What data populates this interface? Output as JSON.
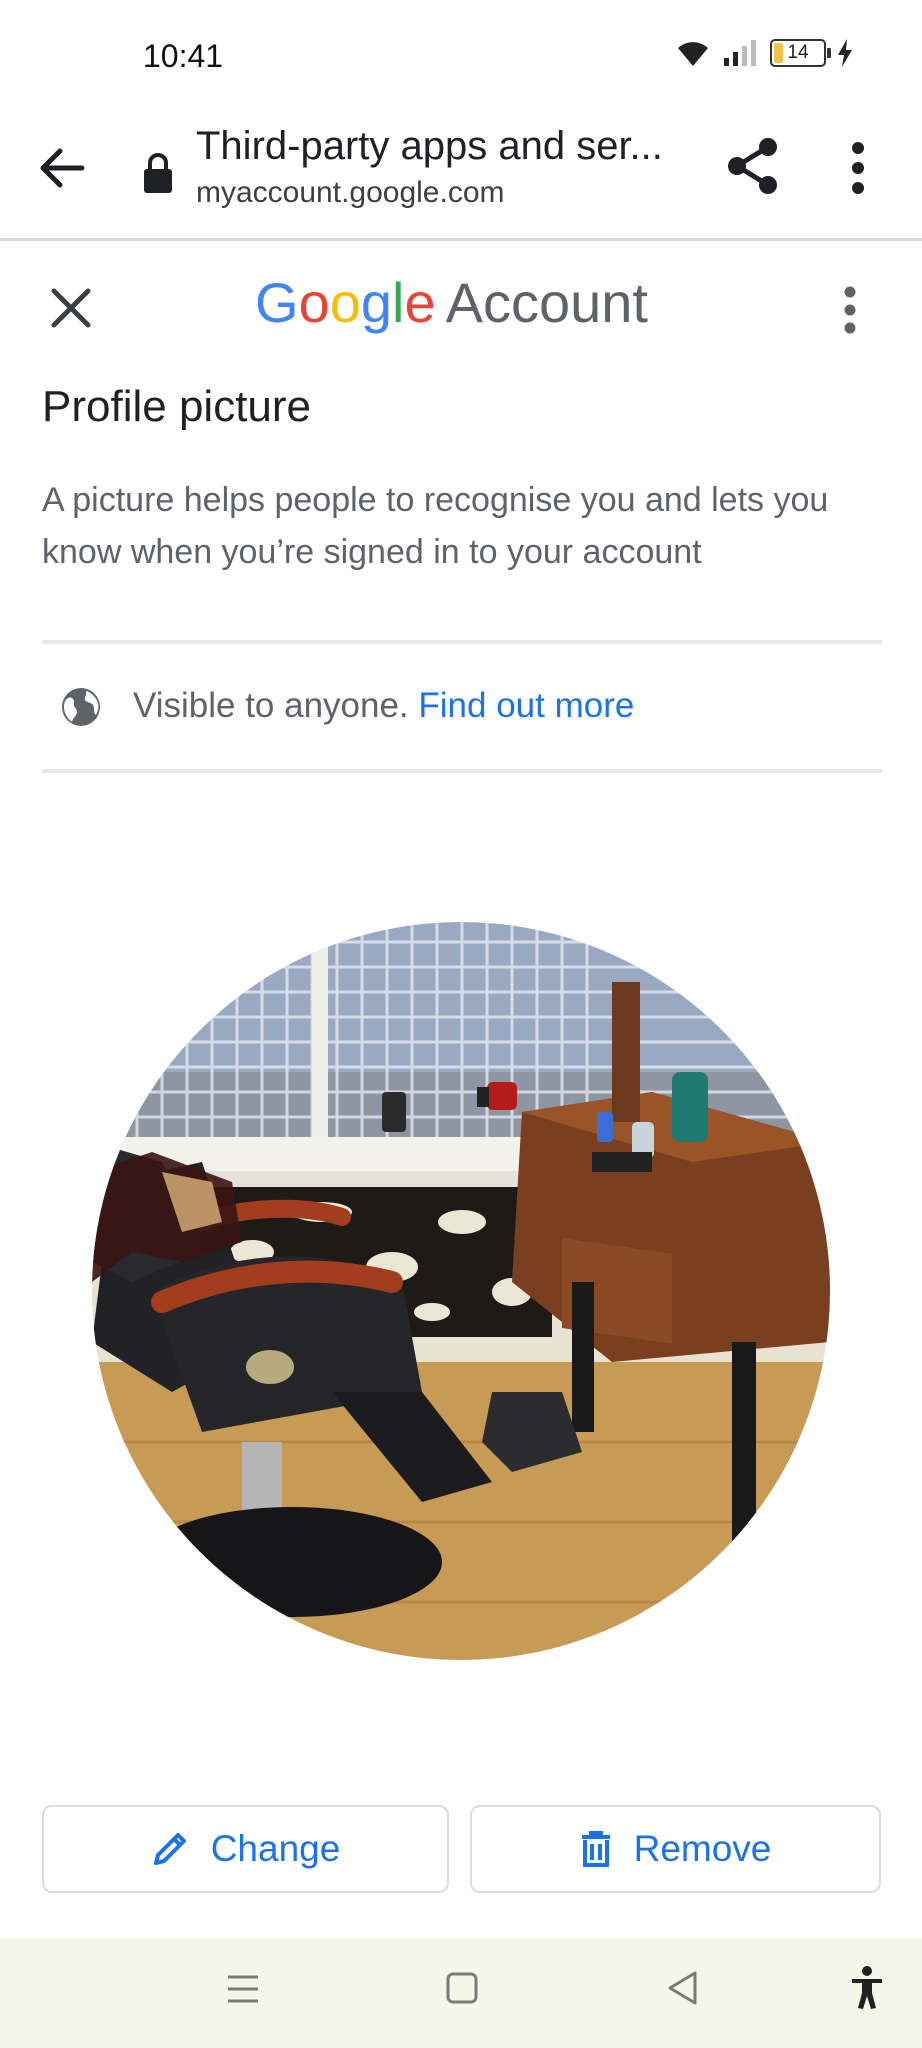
{
  "status_bar": {
    "time": "10:41",
    "battery_level": "14"
  },
  "browser": {
    "title": "Third-party apps and ser...",
    "domain": "myaccount.google.com"
  },
  "header": {
    "logo_letters": [
      "G",
      "o",
      "o",
      "g",
      "l",
      "e"
    ],
    "logo_colors": [
      "#4285F4",
      "#EA4335",
      "#FBBC05",
      "#4285F4",
      "#34A853",
      "#EA4335"
    ],
    "logo_word": "Account"
  },
  "page": {
    "title": "Profile picture",
    "description": "A picture helps people to recognise you and lets you know when you’re signed in to your account",
    "visibility_text": "Visible to anyone.",
    "visibility_link": "Find out more"
  },
  "actions": {
    "change_label": "Change",
    "remove_label": "Remove"
  },
  "colors": {
    "accent": "#1a73e8",
    "nav_bg": "#f4f7e7"
  },
  "icons": [
    "back-arrow-icon",
    "lock-icon",
    "share-icon",
    "more-vert-icon",
    "close-icon",
    "globe-icon",
    "pencil-icon",
    "trash-icon",
    "menu-icon",
    "home-icon",
    "back-triangle-icon",
    "accessibility-icon"
  ]
}
